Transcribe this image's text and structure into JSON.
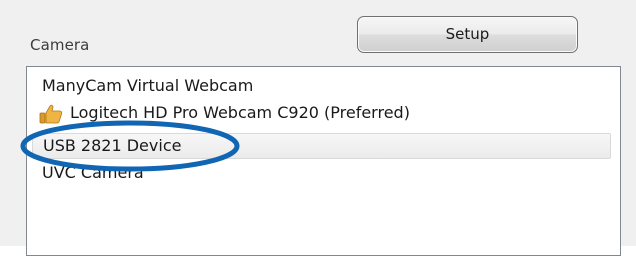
{
  "camera_panel": {
    "label": "Camera",
    "setup_button": "Setup",
    "devices": [
      {
        "name": "ManyCam Virtual Webcam",
        "icon": "",
        "selected": false
      },
      {
        "name": "Logitech HD Pro Webcam C920 (Preferred)",
        "icon": "thumbs-up-icon",
        "selected": false
      },
      {
        "name": "USB 2821 Device",
        "icon": "",
        "selected": true
      },
      {
        "name": "UVC Camera",
        "icon": "",
        "selected": false
      }
    ]
  },
  "colors": {
    "highlight_ellipse": "#1166b4",
    "thumbs_up_icon": "#e8a93a"
  }
}
